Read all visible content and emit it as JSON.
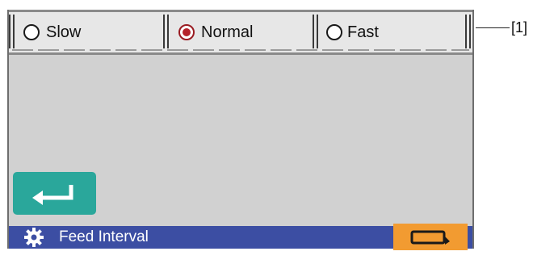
{
  "options": {
    "slow": "Slow",
    "normal": "Normal",
    "fast": "Fast",
    "selected": "Normal"
  },
  "bottom_bar": {
    "title": "Feed Interval",
    "color": "#3c4ea3"
  },
  "callout": "[1]",
  "colors": {
    "enter_button": "#2aa79b",
    "action_button": "#f29b31",
    "selected_radio": "#b5232b"
  },
  "icons": {
    "enter": "enter-icon",
    "gear": "gear-icon",
    "action": "switch-icon"
  }
}
